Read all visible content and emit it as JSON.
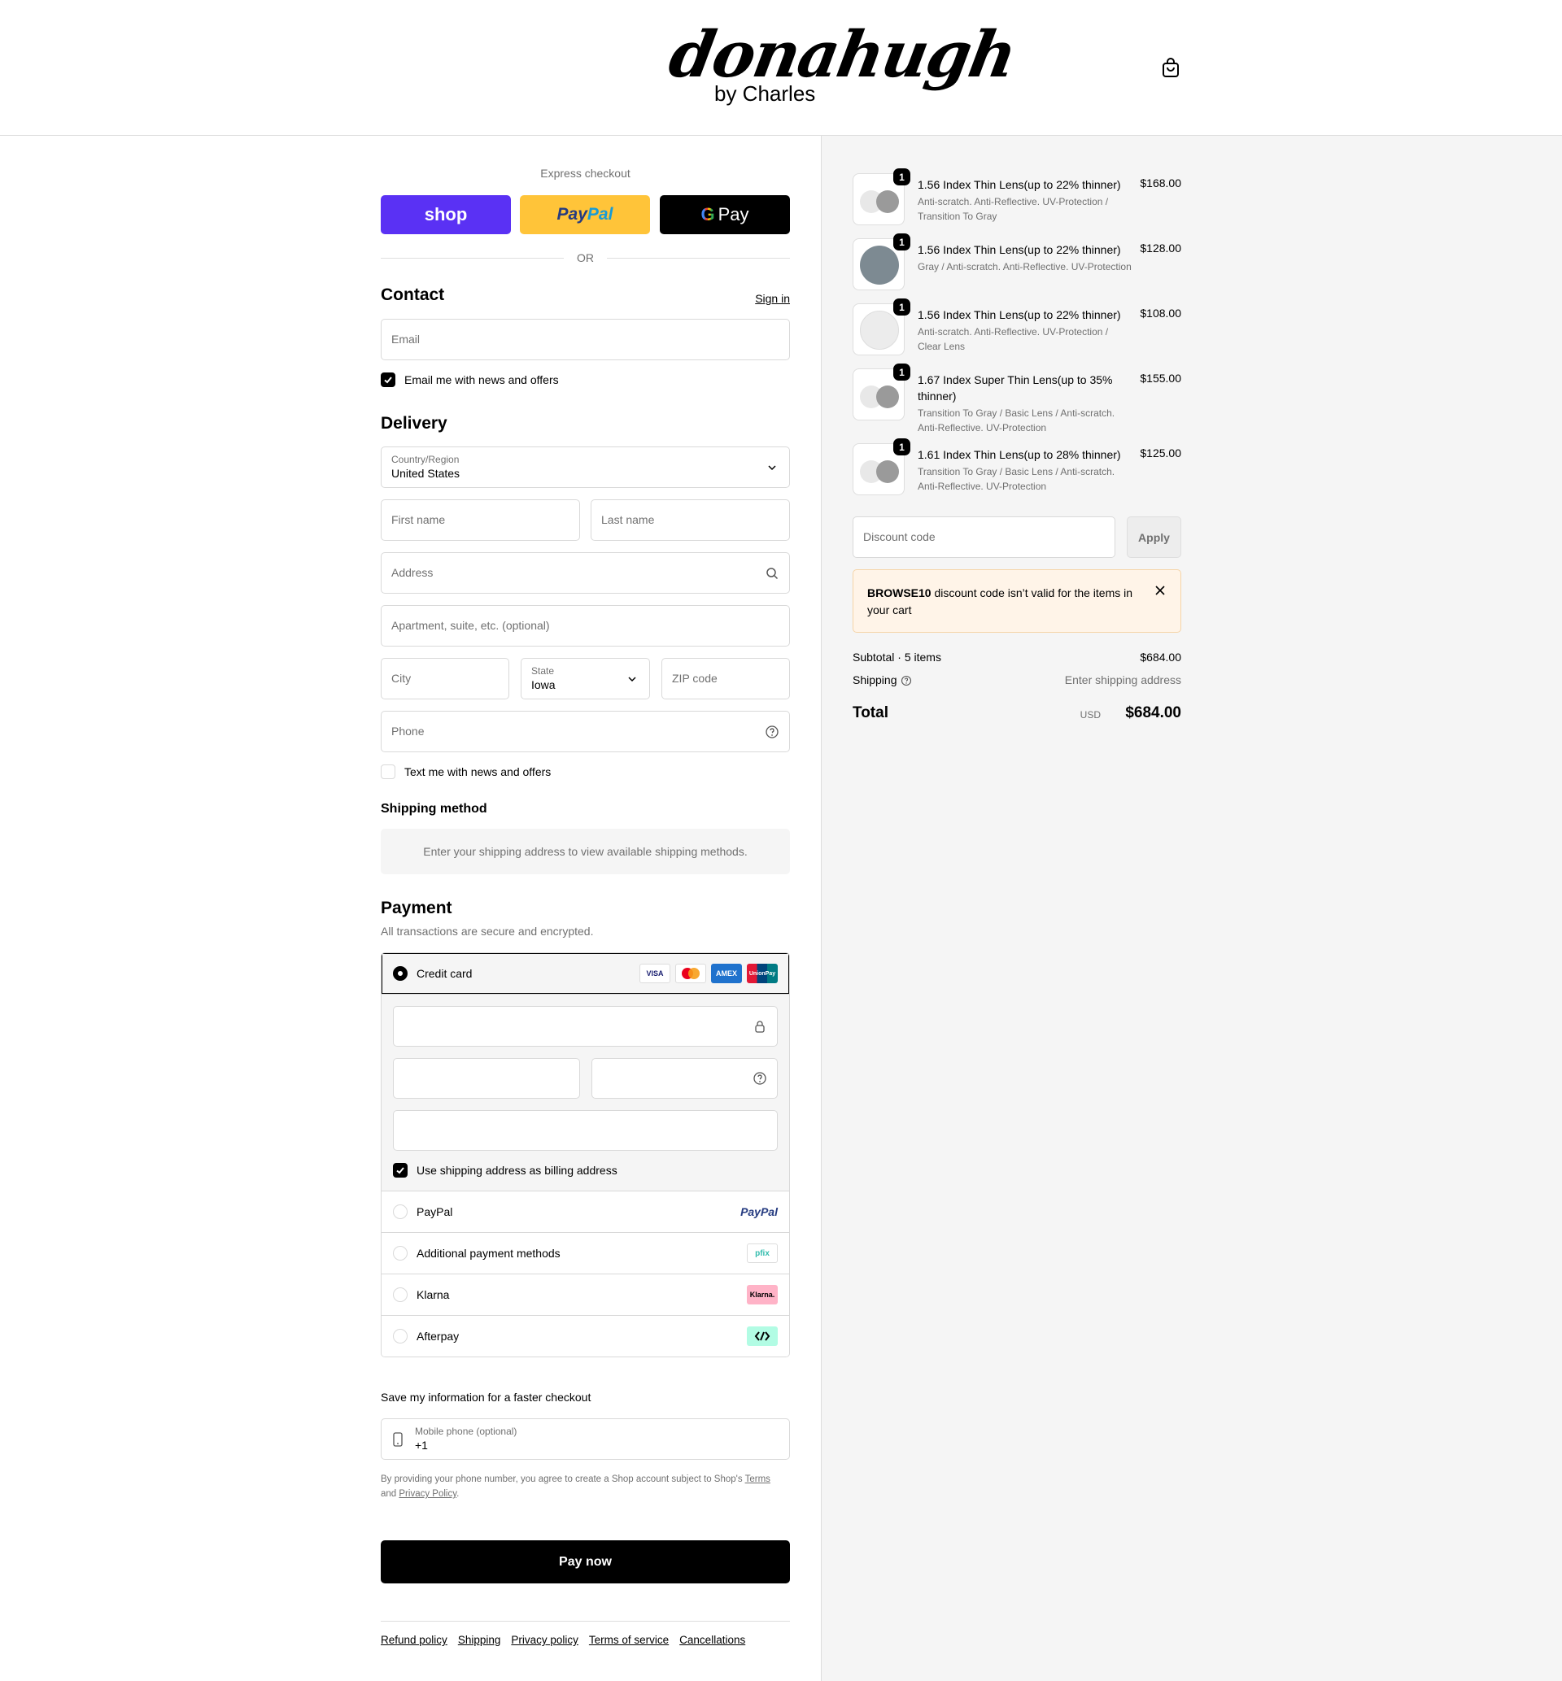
{
  "brand": {
    "script": "donahugh",
    "sub": "by Charles"
  },
  "express": {
    "title": "Express checkout",
    "shop_label": "shop",
    "paypal_a": "Pay",
    "paypal_b": "Pal",
    "gpay_g": "G",
    "gpay_label": "Pay",
    "or": "OR"
  },
  "contact": {
    "title": "Contact",
    "sign_in": "Sign in",
    "email_placeholder": "Email",
    "email_news": "Email me with news and offers"
  },
  "delivery": {
    "title": "Delivery",
    "country_label": "Country/Region",
    "country_value": "United States",
    "first_name": "First name",
    "last_name": "Last name",
    "address": "Address",
    "apartment": "Apartment, suite, etc. (optional)",
    "city": "City",
    "state_label": "State",
    "state_value": "Iowa",
    "zip": "ZIP code",
    "phone": "Phone",
    "text_news": "Text me with news and offers"
  },
  "shipping_method": {
    "title": "Shipping method",
    "note": "Enter your shipping address to view available shipping methods."
  },
  "payment": {
    "title": "Payment",
    "subtitle": "All transactions are secure and encrypted.",
    "credit_card": "Credit card",
    "card_brands": [
      "VISA",
      "",
      "AMEX",
      "UnionPay"
    ],
    "billing_same": "Use shipping address as billing address",
    "options": [
      {
        "label": "PayPal",
        "logo": "PayPal"
      },
      {
        "label": "Additional payment methods",
        "logo": "pfix"
      },
      {
        "label": "Klarna",
        "logo": "Klarna."
      },
      {
        "label": "Afterpay",
        "logo": "afterpay-icon"
      }
    ]
  },
  "save_info": {
    "title": "Save my information for a faster checkout",
    "mobile_label": "Mobile phone (optional)",
    "mobile_value": "+1",
    "note_a": "By providing your phone number, you agree to create a Shop account subject to Shop's ",
    "terms": "Terms",
    "note_b": "and ",
    "privacy": "Privacy Policy",
    "note_c": "."
  },
  "pay_now": "Pay now",
  "footer_links": [
    "Refund policy",
    "Shipping",
    "Privacy policy",
    "Terms of service",
    "Cancellations"
  ],
  "cart": {
    "items": [
      {
        "qty": "1",
        "name": "1.56 Index Thin Lens(up to 22% thinner)",
        "desc": "Anti-scratch. Anti-Reflective. UV-Protection / Transition To Gray",
        "price": "$168.00"
      },
      {
        "qty": "1",
        "name": "1.56 Index Thin Lens(up to 22% thinner)",
        "desc": "Gray / Anti-scratch. Anti-Reflective. UV-Protection",
        "price": "$128.00"
      },
      {
        "qty": "1",
        "name": "1.56 Index Thin Lens(up to 22% thinner)",
        "desc": "Anti-scratch. Anti-Reflective. UV-Protection / Clear Lens",
        "price": "$108.00"
      },
      {
        "qty": "1",
        "name": "1.67 Index Super Thin Lens(up to 35% thinner)",
        "desc": "Transition To Gray / Basic Lens / Anti-scratch. Anti-Reflective. UV-Protection",
        "price": "$155.00"
      },
      {
        "qty": "1",
        "name": "1.61 Index Thin Lens(up to 28% thinner)",
        "desc": "Transition To Gray / Basic Lens / Anti-scratch. Anti-Reflective. UV-Protection",
        "price": "$125.00"
      }
    ],
    "discount_placeholder": "Discount code",
    "apply": "Apply",
    "alert_code": "BROWSE10",
    "alert_text": " discount code isn’t valid for the items in your cart",
    "subtotal_label": "Subtotal · 5 items",
    "subtotal_value": "$684.00",
    "shipping_label": "Shipping",
    "shipping_value": "Enter shipping address",
    "total_label": "Total",
    "total_currency": "USD",
    "total_value": "$684.00"
  },
  "colors": {
    "shop": "#5a31f4",
    "paypal": "#ffc439",
    "accent": "#000000",
    "alert_bg": "#fff4e8"
  }
}
